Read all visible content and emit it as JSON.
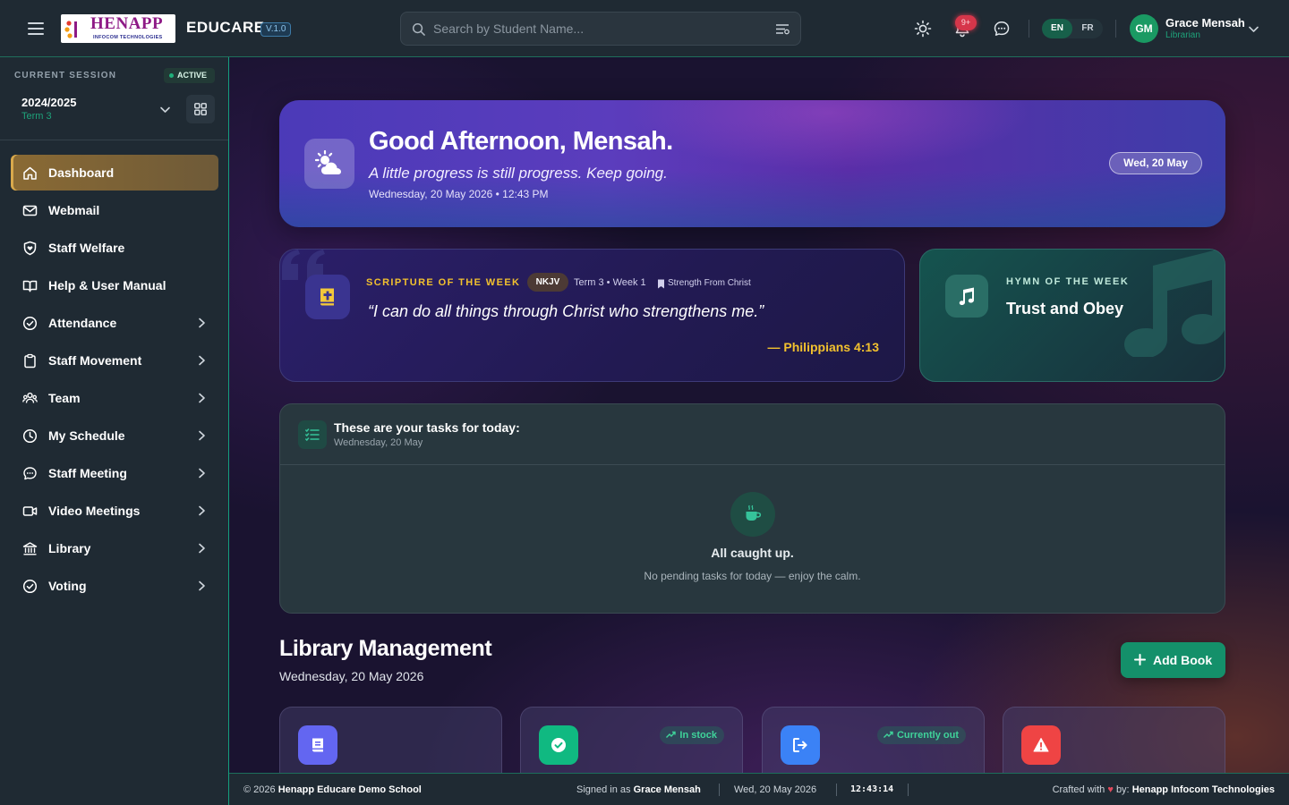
{
  "header": {
    "logo": {
      "name": "HENAPP",
      "sub": "INFOCOM TECHNOLOGIES"
    },
    "brand": "EDUCARE",
    "version": "V.1.0",
    "search_placeholder": "Search by Student Name...",
    "notif_badge": "9+",
    "languages": [
      "EN",
      "FR"
    ],
    "user": {
      "initials": "GM",
      "name": "Grace Mensah",
      "role": "Librarian"
    }
  },
  "sidebar": {
    "session": {
      "label": "CURRENT SESSION",
      "badge": "ACTIVE",
      "year": "2024/2025",
      "term": "Term 3"
    },
    "items": [
      {
        "label": "Dashboard",
        "icon": "home-icon",
        "active": true,
        "has_children": false
      },
      {
        "label": "Webmail",
        "icon": "mail-icon",
        "has_children": false
      },
      {
        "label": "Staff Welfare",
        "icon": "shield-heart-icon",
        "has_children": false
      },
      {
        "label": "Help & User Manual",
        "icon": "book-open-icon",
        "has_children": false
      },
      {
        "label": "Attendance",
        "icon": "check-circle-icon",
        "has_children": true
      },
      {
        "label": "Staff Movement",
        "icon": "clipboard-icon",
        "has_children": true
      },
      {
        "label": "Team",
        "icon": "users-icon",
        "has_children": true
      },
      {
        "label": "My Schedule",
        "icon": "clock-icon",
        "has_children": true
      },
      {
        "label": "Staff Meeting",
        "icon": "chat-bubble-icon",
        "has_children": true
      },
      {
        "label": "Video Meetings",
        "icon": "video-icon",
        "has_children": true
      },
      {
        "label": "Library",
        "icon": "library-icon",
        "has_children": true
      },
      {
        "label": "Voting",
        "icon": "check-circle-icon",
        "has_children": true
      }
    ]
  },
  "hero": {
    "title": "Good Afternoon, Mensah.",
    "subtitle": "A little progress is still progress. Keep going.",
    "datetime": "Wednesday, 20 May 2026 • 12:43 PM",
    "pill": "Wed, 20 May"
  },
  "scripture": {
    "label": "SCRIPTURE OF THE WEEK",
    "version": "NKJV",
    "meta": "Term 3 • Week 1",
    "theme": "Strength From Christ",
    "quote": "“I can do all things through Christ who strengthens me.”",
    "reference": "— Philippians 4:13"
  },
  "hymn": {
    "label": "HYMN OF THE WEEK",
    "title": "Trust and Obey"
  },
  "tasks": {
    "title": "These are your tasks for today:",
    "date": "Wednesday, 20 May",
    "empty_title": "All caught up.",
    "empty_sub": "No pending tasks for today — enjoy the calm."
  },
  "library": {
    "title": "Library Management",
    "date": "Wednesday, 20 May 2026",
    "add_button": "Add Book",
    "cards": [
      {
        "icon": "book-icon",
        "color": "#6366f1",
        "tag": ""
      },
      {
        "icon": "check-badge-icon",
        "color": "#10b981",
        "tag": "In stock"
      },
      {
        "icon": "sign-out-icon",
        "color": "#3b82f6",
        "tag": "Currently out"
      },
      {
        "icon": "warning-icon",
        "color": "#ef4444",
        "tag": ""
      }
    ]
  },
  "footer": {
    "copyright_prefix": "© 2026",
    "school": "Henapp Educare Demo School",
    "signed_prefix": "Signed in as",
    "signed_user": "Grace Mensah",
    "date": "Wed, 20 May 2026",
    "time": "12:43:14",
    "crafted_prefix": "Crafted with",
    "crafted_by": "by:",
    "company": "Henapp Infocom Technologies"
  },
  "colors": {
    "accent_green": "#14906a",
    "active_nav": "#8a6a34",
    "scripture_gold": "#f2c12e",
    "hero_purple": "#5b3dbd"
  }
}
